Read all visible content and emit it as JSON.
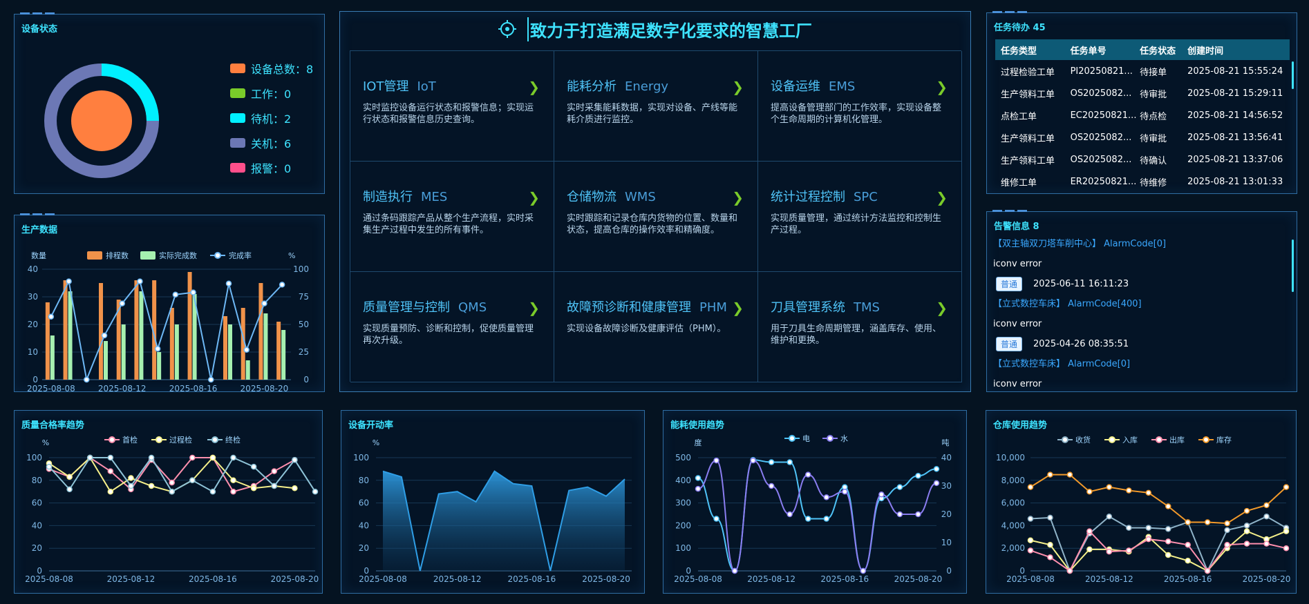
{
  "device_status": {
    "title": "设备状态",
    "legend": [
      {
        "label": "设备总数：8",
        "color": "#ff7f3f"
      },
      {
        "label": "工作：0",
        "color": "#7acb2a"
      },
      {
        "label": "待机：2",
        "color": "#00f0ff"
      },
      {
        "label": "关机：6",
        "color": "#6c78b5"
      },
      {
        "label": "报警：0",
        "color": "#ff4f8b"
      }
    ],
    "ring": {
      "standby": 2,
      "off": 6,
      "total": 8
    }
  },
  "header": {
    "title": "致力于打造满足数字化要求的智慧工厂",
    "target_icon": "crosshair-icon"
  },
  "modules": [
    {
      "cn": "IOT管理",
      "en": "IoT",
      "desc": "实时监控设备运行状态和报警信息；实现运行状态和报警信息历史查询。"
    },
    {
      "cn": "能耗分析",
      "en": "Energy",
      "desc": "实时采集能耗数据，实现对设备、产线等能耗介质进行监控。"
    },
    {
      "cn": "设备运维",
      "en": "EMS",
      "desc": "提高设备管理部门的工作效率，实现设备整个生命周期的计算机化管理。"
    },
    {
      "cn": "制造执行",
      "en": "MES",
      "desc": "通过条码跟踪产品从整个生产流程，实时采集生产过程中发生的所有事件。"
    },
    {
      "cn": "仓储物流",
      "en": "WMS",
      "desc": "实时跟踪和记录仓库内货物的位置、数量和状态，提高仓库的操作效率和精确度。"
    },
    {
      "cn": "统计过程控制",
      "en": "SPC",
      "desc": "实现质量管理，通过统计方法监控和控制生产过程。"
    },
    {
      "cn": "质量管理与控制",
      "en": "QMS",
      "desc": "实现质量预防、诊断和控制，促使质量管理再次升级。"
    },
    {
      "cn": "故障预诊断和健康管理",
      "en": "PHM",
      "desc": "实现设备故障诊断及健康评估（PHM）。"
    },
    {
      "cn": "刀具管理系统",
      "en": "TMS",
      "desc": "用于刀具生命周期管理，涵盖库存、使用、维护和更换。"
    }
  ],
  "tasks": {
    "title": "任务待办 45",
    "headers": [
      "任务类型",
      "任务单号",
      "任务状态",
      "创建时间"
    ],
    "rows": [
      [
        "过程检验工单",
        "PI20250821...",
        "待接单",
        "2025-08-21 15:55:24"
      ],
      [
        "生产领料工单",
        "OS2025082...",
        "待审批",
        "2025-08-21 15:29:11"
      ],
      [
        "点检工单",
        "EC20250821...",
        "待点检",
        "2025-08-21 14:56:52"
      ],
      [
        "生产领料工单",
        "OS2025082...",
        "待审批",
        "2025-08-21 13:56:41"
      ],
      [
        "生产领料工单",
        "OS2025082...",
        "待确认",
        "2025-08-21 13:37:06"
      ],
      [
        "维修工单",
        "ER20250821...",
        "待维修",
        "2025-08-21 13:01:33"
      ]
    ]
  },
  "alarms": {
    "title": "告警信息 8",
    "items": [
      {
        "src": "【双主轴双刀塔车削中心】 AlarmCode[0]",
        "msg": "iconv error",
        "level": "普通",
        "time": "2025-06-11 16:11:23"
      },
      {
        "src": "【立式数控车床】 AlarmCode[400]",
        "msg": "iconv error",
        "level": "普通",
        "time": "2025-04-26 08:35:51"
      },
      {
        "src": "【立式数控车床】 AlarmCode[0]",
        "msg": "iconv error",
        "level": "",
        "time": ""
      }
    ]
  },
  "chart_data": [
    {
      "id": "production",
      "title": "生产数据",
      "type": "bar",
      "ylabel": "数量",
      "y2label": "%",
      "ylim": [
        0,
        40
      ],
      "y2lim": [
        0,
        100
      ],
      "x_ticks": [
        "2025-08-08",
        "2025-08-12",
        "2025-08-16",
        "2025-08-20"
      ],
      "categories": [
        "08-08",
        "08-09",
        "08-10",
        "08-11",
        "08-12",
        "08-13",
        "08-14",
        "08-15",
        "08-16",
        "08-17",
        "08-18",
        "08-19",
        "08-20",
        "08-21"
      ],
      "series": [
        {
          "name": "排程数",
          "color": "#f0924a",
          "values": [
            28,
            36,
            0,
            35,
            29,
            36,
            36,
            26,
            39,
            0,
            23,
            26,
            35,
            21
          ]
        },
        {
          "name": "实际完成数",
          "color": "#a6f0b0",
          "values": [
            16,
            32,
            0,
            14,
            20,
            32,
            10,
            20,
            31,
            0,
            20,
            7,
            24,
            18
          ]
        },
        {
          "name": "完成率",
          "color": "#6eb8f5",
          "axis": "right",
          "values": [
            57,
            89,
            0,
            40,
            69,
            89,
            28,
            77,
            79,
            0,
            87,
            27,
            69,
            86
          ]
        }
      ]
    },
    {
      "id": "quality",
      "title": "质量合格率趋势",
      "type": "line",
      "ylabel": "%",
      "ylim": [
        0,
        100
      ],
      "x_ticks": [
        "2025-08-08",
        "2025-08-12",
        "2025-08-16",
        "2025-08-20"
      ],
      "series": [
        {
          "name": "首检",
          "color": "#ff8fae",
          "values": [
            90,
            83,
            100,
            88,
            72,
            98,
            78,
            100,
            100,
            70,
            75,
            88,
            98
          ]
        },
        {
          "name": "过程检",
          "color": "#f5f08a",
          "values": [
            95,
            83,
            100,
            70,
            82,
            75,
            70,
            80,
            100,
            80,
            73,
            75,
            73
          ]
        },
        {
          "name": "终检",
          "color": "#8fc4d8",
          "values": [
            92,
            72,
            100,
            100,
            75,
            100,
            70,
            80,
            70,
            100,
            92,
            75,
            98,
            70
          ]
        }
      ]
    },
    {
      "id": "uptime",
      "title": "设备开动率",
      "type": "area",
      "ylabel": "%",
      "ylim": [
        0,
        100
      ],
      "x_ticks": [
        "2025-08-08",
        "2025-08-12",
        "2025-08-16",
        "2025-08-20"
      ],
      "series": [
        {
          "name": "",
          "color": "#2f9ee6",
          "values": [
            88,
            83,
            0,
            68,
            70,
            61,
            88,
            77,
            75,
            0,
            71,
            74,
            66,
            81
          ]
        }
      ]
    },
    {
      "id": "energy",
      "title": "能耗使用趋势",
      "type": "line",
      "ylabel": "度",
      "y2label": "吨",
      "ylim": [
        0,
        500
      ],
      "y2lim": [
        0,
        40
      ],
      "x_ticks": [
        "2025-08-08",
        "2025-08-12",
        "2025-08-16",
        "2025-08-20"
      ],
      "series": [
        {
          "name": "电",
          "color": "#4fc3f7",
          "values": [
            410,
            230,
            0,
            490,
            480,
            480,
            230,
            230,
            370,
            0,
            320,
            370,
            420,
            450
          ]
        },
        {
          "name": "水",
          "color": "#8a7df0",
          "axis": "right",
          "values": [
            29,
            39,
            0,
            39,
            30,
            20,
            34,
            26,
            28,
            0,
            27,
            20,
            20,
            31
          ]
        }
      ]
    },
    {
      "id": "warehouse",
      "title": "仓库使用趋势",
      "type": "line",
      "ylim": [
        0,
        10000
      ],
      "y_ticks": [
        "0",
        "2,000",
        "4,000",
        "6,000",
        "8,000",
        "10,000"
      ],
      "x_ticks": [
        "2025-08-08",
        "2025-08-12",
        "2025-08-16",
        "2025-08-20"
      ],
      "series": [
        {
          "name": "收货",
          "color": "#8fb3c8",
          "values": [
            4600,
            4700,
            0,
            3300,
            4800,
            3800,
            3800,
            3700,
            4300,
            0,
            3600,
            4000,
            4800,
            3800
          ]
        },
        {
          "name": "入库",
          "color": "#f5f08a",
          "values": [
            2700,
            2300,
            0,
            1900,
            1900,
            1700,
            3000,
            1400,
            900,
            0,
            2000,
            3500,
            2800,
            3500
          ]
        },
        {
          "name": "出库",
          "color": "#ff8fae",
          "values": [
            1800,
            1200,
            0,
            3500,
            1700,
            1800,
            2800,
            2600,
            2300,
            0,
            2300,
            2400,
            2400,
            2000
          ]
        },
        {
          "name": "库存",
          "color": "#f39a2a",
          "values": [
            7400,
            8500,
            8500,
            7000,
            7400,
            7100,
            6900,
            5700,
            4300,
            4300,
            4200,
            5300,
            5800,
            7400
          ]
        }
      ]
    }
  ]
}
